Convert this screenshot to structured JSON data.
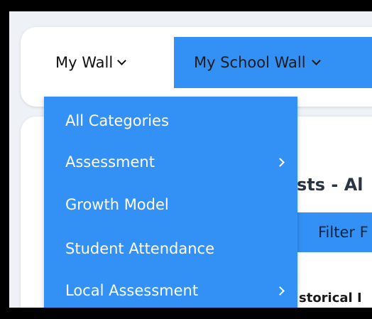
{
  "tabs": {
    "my_wall": {
      "label": "My Wall",
      "icon": "chevron-down-icon"
    },
    "my_school_wall": {
      "label": "My School Wall",
      "icon": "chevron-down-icon"
    }
  },
  "dropdown": {
    "items": [
      {
        "label": "All Categories",
        "has_submenu": false
      },
      {
        "label": "Assessment",
        "has_submenu": true,
        "icon": "chevron-right-icon"
      },
      {
        "label": "Growth Model",
        "has_submenu": false
      },
      {
        "label": "Student Attendance",
        "has_submenu": false
      },
      {
        "label": "Local Assessment",
        "has_submenu": true,
        "icon": "chevron-right-icon"
      }
    ]
  },
  "content": {
    "heading": "sts - Al",
    "filter_button": "Filter F",
    "subheading": "storical I"
  },
  "colors": {
    "accent": "#3391f5",
    "frame": "#000000",
    "background": "#eef2f7",
    "card": "#ffffff",
    "menu_text": "#ffffff"
  }
}
